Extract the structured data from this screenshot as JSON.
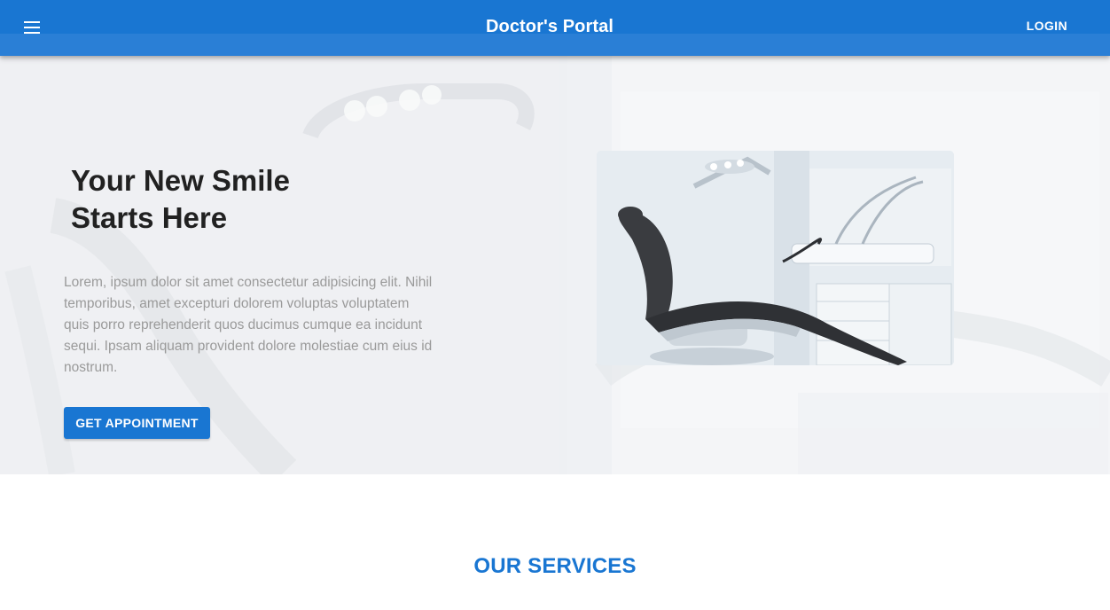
{
  "appbar": {
    "title": "Doctor's Portal",
    "login_label": "LOGIN",
    "menu_icon": "hamburger-menu-icon",
    "color": "#1976d2"
  },
  "hero": {
    "title_line1": "Your New Smile",
    "title_line2": "Starts Here",
    "description": "Lorem, ipsum dolor sit amet consectetur adipisicing elit. Nihil temporibus, amet excepturi dolorem voluptas voluptatem quis porro reprehenderit quos ducimus cumque ea incidunt sequi. Ipsam aliquam provident dolore molestiae cum eius id nostrum.",
    "cta_label": "GET APPOINTMENT",
    "image": "dental-chair-image"
  },
  "services": {
    "title": "OUR SERVICES"
  },
  "colors": {
    "primary": "#1976d2",
    "heading": "#212121",
    "body_text": "#9a9a9a"
  }
}
